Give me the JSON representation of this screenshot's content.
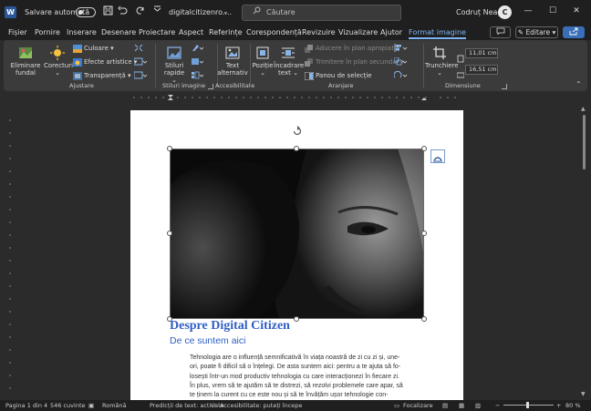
{
  "titlebar": {
    "app_logo": "W",
    "autosave_label": "Salvare automată",
    "autosave_on": false,
    "doc_title": "digitalcitizenro....",
    "search_placeholder": "Căutare",
    "user_name": "Codruț Neagu",
    "avatar_initial": "C",
    "qat_icons": [
      "save-icon",
      "undo-icon",
      "redo-icon",
      "customize-qat-icon"
    ],
    "window_controls": [
      "minimize",
      "maximize",
      "close"
    ]
  },
  "menubar": {
    "items": [
      "Fișier",
      "Pornire",
      "Inserare",
      "Desenare",
      "Proiectare",
      "Aspect",
      "Referințe",
      "Corespondență",
      "Revizuire",
      "Vizualizare",
      "Ajutor",
      "Format imagine"
    ],
    "active": "Format imagine",
    "editing_label": "Editare",
    "comments_icon": "comment-icon",
    "share_icon": "share-icon"
  },
  "ribbon": {
    "adjust": {
      "remove_bg": "Eliminare fundal",
      "corrections": "Corecturi",
      "color": "Culoare",
      "artistic": "Efecte artistice",
      "transparency": "Transparență",
      "label": "Ajustare"
    },
    "styles": {
      "quick_styles": "Stiluri rapide",
      "label": "Stiluri imagine"
    },
    "accessibility": {
      "alt_text": "Text alternativ",
      "label": "Accesibilitate"
    },
    "arrange": {
      "position": "Poziție",
      "wrap_text": "Încadrare text",
      "bring_forward": "Aducere în plan apropiat",
      "send_backward": "Trimitere în plan secundar",
      "selection_pane": "Panou de selecție",
      "label": "Aranjare"
    },
    "size": {
      "crop": "Trunchiere",
      "height": "11,01 cm",
      "width": "16,51 cm",
      "label": "Dimensiune"
    }
  },
  "document": {
    "heading": "Despre Digital Citizen",
    "subheading": "De ce suntem aici",
    "body_lines": [
      "Tehnologia are o influență semnificativă în viața noastră de zi cu zi și, une-",
      "ori, poate fi dificil să o înțelegi. De asta suntem aici: pentru a te ajuta să fo-",
      "losești într-un mod productiv tehnologia cu care interacționezi în fiecare zi.",
      "În plus, vrem să te ajutăm să te distrezi, să rezolvi problemele care apar, să",
      "te ținem la curent cu ce este nou și să te învățăm ușor tehnologie con-"
    ]
  },
  "statusbar": {
    "page": "Pagina 1 din 4",
    "words": "546 cuvinte",
    "language": "Română",
    "predictions": "Predicții de text: activate",
    "accessibility": "Accesibilitate: puteți începe",
    "focus": "Focalizare",
    "zoom": "80 %",
    "zoom_level": 0.8
  },
  "colors": {
    "accent": "#7eb6f5",
    "heading": "#2f5fc4",
    "ribbon_bg": "#3b3b3b",
    "titlebar_bg": "#1f1f1f"
  }
}
